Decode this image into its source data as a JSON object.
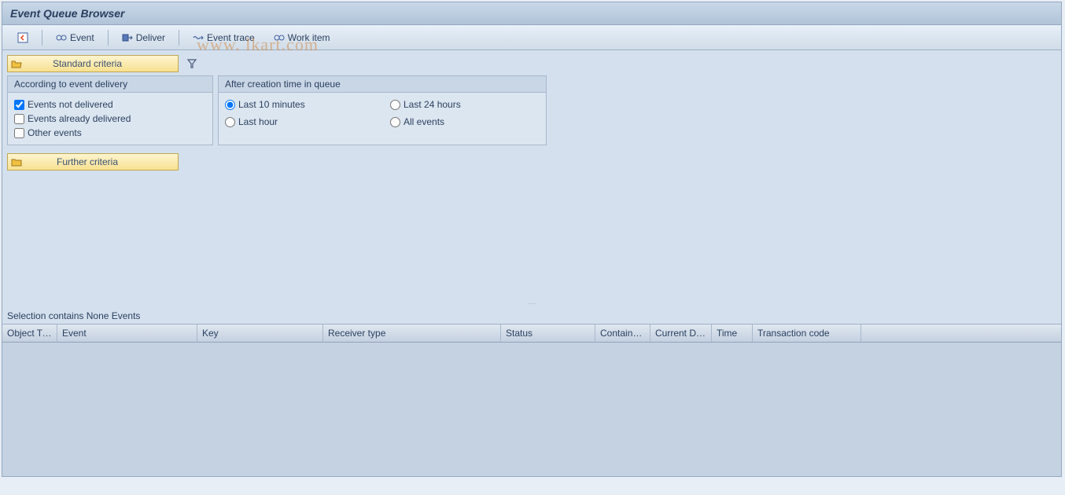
{
  "title": "Event Queue Browser",
  "toolbar": {
    "event": "Event",
    "deliver": "Deliver",
    "trace": "Event trace",
    "workitem": "Work item"
  },
  "criteria": {
    "standard_btn": "Standard criteria",
    "further_btn": "Further criteria",
    "delivery_title": "According to event delivery",
    "time_title": "After creation time in queue",
    "checks": {
      "not_delivered": "Events not delivered",
      "already_delivered": "Events already delivered",
      "other": "Other events"
    },
    "radios": {
      "r10": "Last 10 minutes",
      "r24": "Last 24 hours",
      "rhour": "Last hour",
      "rall": "All events"
    }
  },
  "status": "Selection contains None Events",
  "columns": {
    "objtype": "Object Type",
    "event": "Event",
    "key": "Key",
    "recv": "Receiver type",
    "status": "Status",
    "cont": "Container e..",
    "date": "Current Date",
    "time": "Time",
    "tcode": "Transaction code"
  },
  "watermark": "www.         lkart.com"
}
